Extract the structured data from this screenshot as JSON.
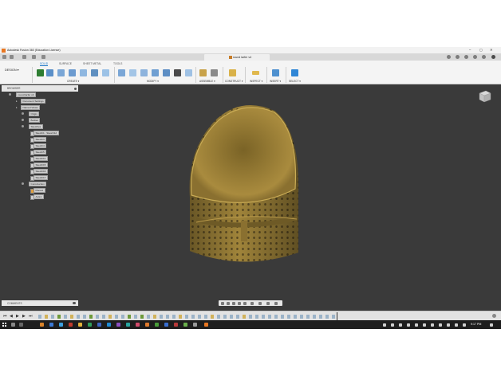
{
  "titlebar": {
    "title": "Autodesk Fusion 360 (Education License)",
    "minimize": "–",
    "maximize": "◻",
    "close": "✕"
  },
  "document": {
    "tab_title": "round larfer v4"
  },
  "workspace": {
    "design_label": "DESIGN ▾",
    "tabs": [
      "SOLID",
      "SURFACE",
      "SHEET METAL",
      "TOOLS"
    ],
    "active_tab": "SOLID",
    "groups": [
      "CREATE ▾",
      "MODIFY ▾",
      "ASSEMBLE ▾",
      "CONSTRUCT ▾",
      "INSPECT ▾",
      "INSERT ▾",
      "SELECT ▾"
    ]
  },
  "browser": {
    "title": "BROWSER",
    "nodes": [
      {
        "label": "round larfer v4",
        "level": 0
      },
      {
        "label": "Document Settings",
        "level": 1
      },
      {
        "label": "Named Views",
        "level": 1
      },
      {
        "label": "Origin",
        "level": 1
      },
      {
        "label": "Bodies",
        "level": 1
      },
      {
        "label": "Sketches",
        "level": 1
      },
      {
        "label": "Sketch1 : Sketch12",
        "level": 2
      },
      {
        "label": "Sketch3",
        "level": 2
      },
      {
        "label": "Sketch4",
        "level": 2
      },
      {
        "label": "Sketch5",
        "level": 2
      },
      {
        "label": "Sketch11",
        "level": 2
      },
      {
        "label": "Sketch15",
        "level": 2
      },
      {
        "label": "Sketch16",
        "level": 2
      },
      {
        "label": "Sketch17",
        "level": 2
      },
      {
        "label": "Construction",
        "level": 1
      },
      {
        "label": "Plane1",
        "level": 2
      },
      {
        "label": "Axis1",
        "level": 2
      }
    ]
  },
  "comments": {
    "title": "COMMENTS"
  },
  "taskbar": {
    "time": "9:17 PM"
  },
  "colors": {
    "canvas": "#3a3a3a",
    "model_gold": "#a88a3c",
    "accent_blue": "#1f78c8",
    "taskbar": "#1e1e1e"
  }
}
